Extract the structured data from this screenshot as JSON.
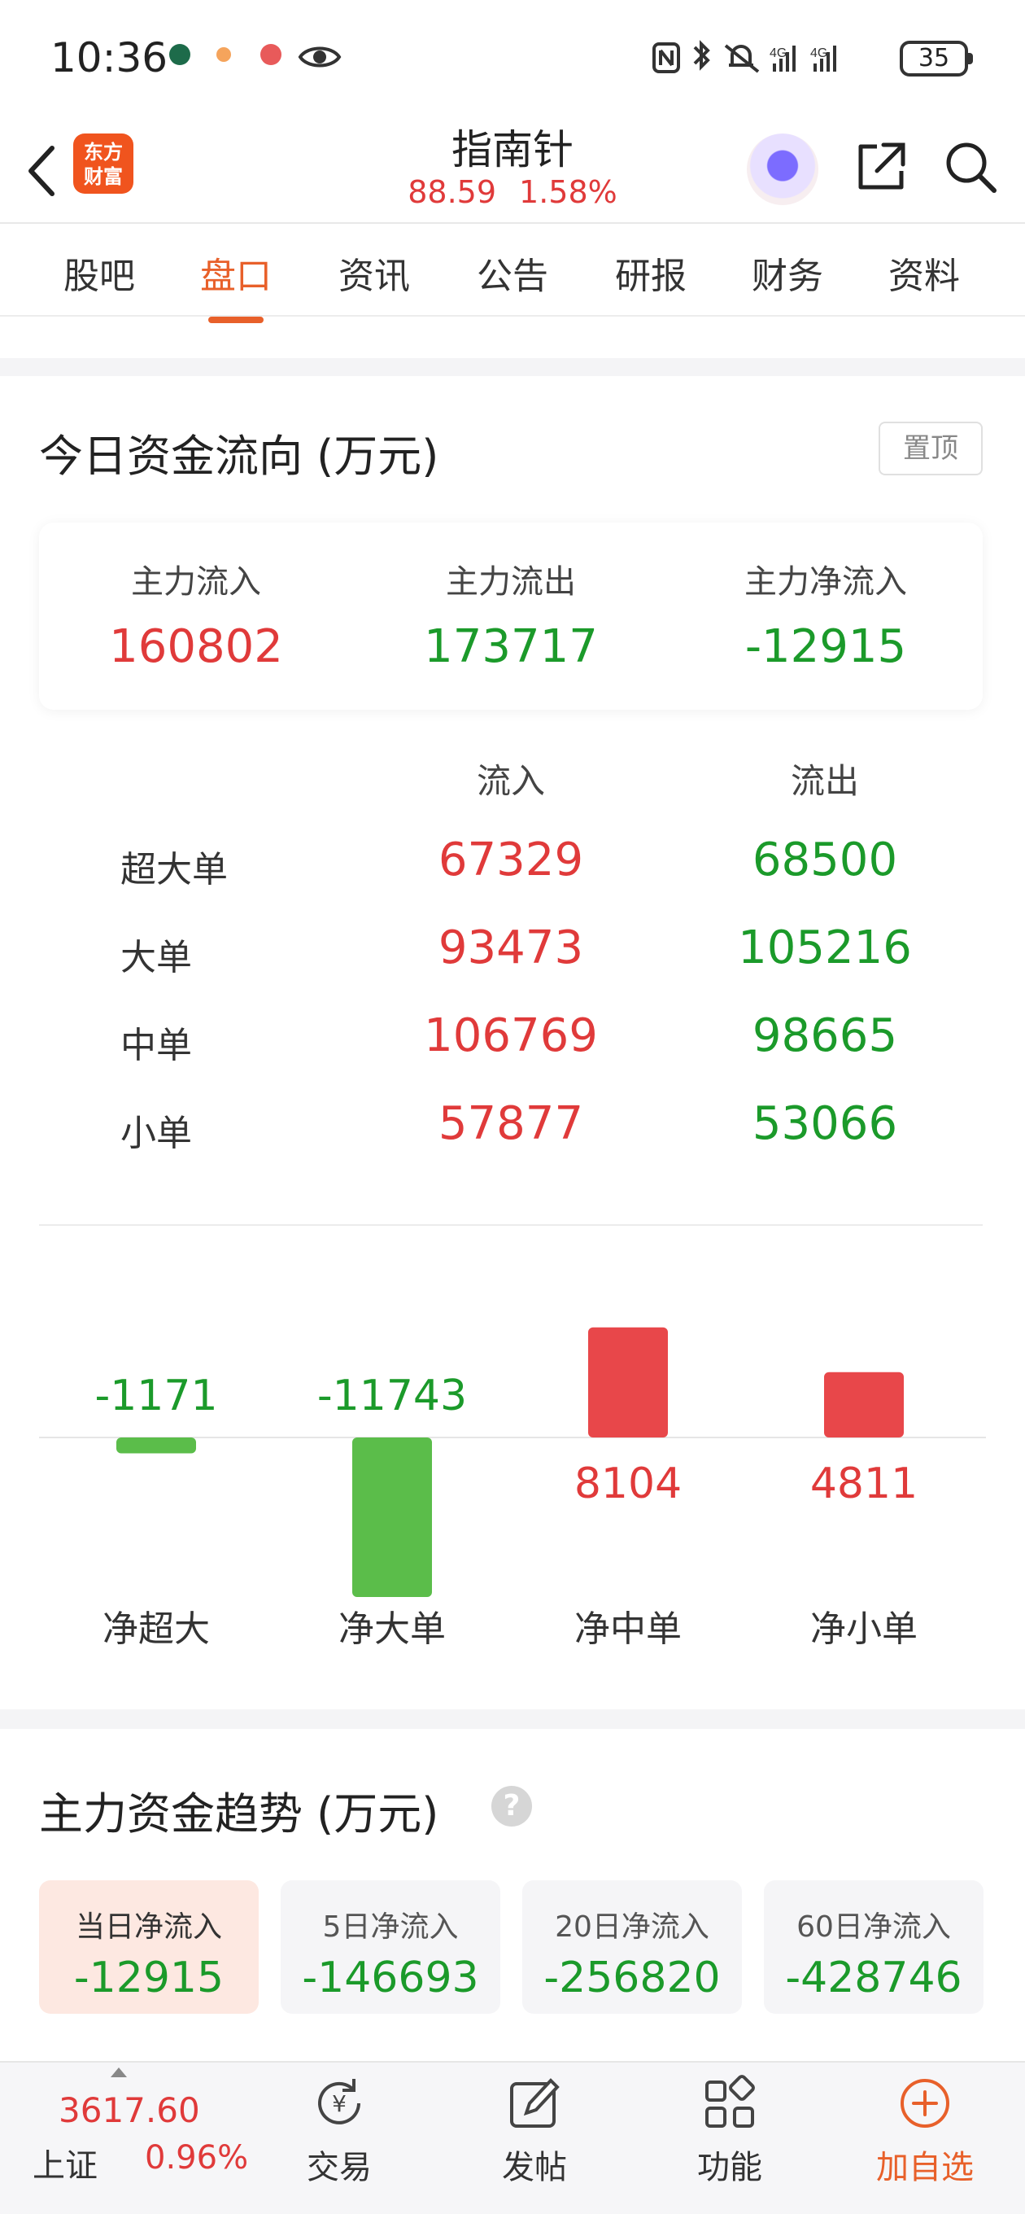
{
  "status_bar": {
    "time": "10:36",
    "battery": "35"
  },
  "header": {
    "logo_line1": "东方",
    "logo_line2": "财富",
    "stock_name": "指南针",
    "price": "88.59",
    "change_pct": "1.58%"
  },
  "tabs": [
    {
      "label": "股吧"
    },
    {
      "label": "盘口",
      "active": true
    },
    {
      "label": "资讯"
    },
    {
      "label": "公告"
    },
    {
      "label": "研报"
    },
    {
      "label": "财务"
    },
    {
      "label": "资料"
    }
  ],
  "fund_flow": {
    "title": "今日资金流向 (万元)",
    "pin_label": "置顶",
    "summary": {
      "inflow_label": "主力流入",
      "inflow": "160802",
      "outflow_label": "主力流出",
      "outflow": "173717",
      "net_label": "主力净流入",
      "net": "-12915"
    },
    "grid": {
      "in_header": "流入",
      "out_header": "流出",
      "rows": [
        {
          "label": "超大单",
          "in": "67329",
          "out": "68500"
        },
        {
          "label": "大单",
          "in": "93473",
          "out": "105216"
        },
        {
          "label": "中单",
          "in": "106769",
          "out": "98665"
        },
        {
          "label": "小单",
          "in": "57877",
          "out": "53066"
        }
      ]
    }
  },
  "chart_data": {
    "type": "bar",
    "categories": [
      "净超大",
      "净大单",
      "净中单",
      "净小单"
    ],
    "values": [
      -1171,
      -11743,
      8104,
      4811
    ],
    "labels": [
      "-1171",
      "-11743",
      "8104",
      "4811"
    ],
    "positive_color": "#e8474a",
    "negative_color": "#5bbd4a"
  },
  "trend": {
    "title": "主力资金趋势 (万元)",
    "help": "?",
    "cards": [
      {
        "label": "当日净流入",
        "value": "-12915",
        "active": true
      },
      {
        "label": "5日净流入",
        "value": "-146693"
      },
      {
        "label": "20日净流入",
        "value": "-256820"
      },
      {
        "label": "60日净流入",
        "value": "-428746"
      }
    ]
  },
  "bottom_bar": {
    "index_value": "3617.60",
    "index_name": "上证",
    "index_change": "0.96%",
    "nav": [
      {
        "label": "交易",
        "icon": "yen-exchange-icon"
      },
      {
        "label": "发帖",
        "icon": "edit-icon"
      },
      {
        "label": "功能",
        "icon": "grid-icon"
      },
      {
        "label": "加自选",
        "icon": "add-circle-icon",
        "accent": true
      }
    ]
  },
  "colors": {
    "accent": "#e8602a",
    "up": "#e03a3a",
    "down": "#1b9a2a"
  }
}
